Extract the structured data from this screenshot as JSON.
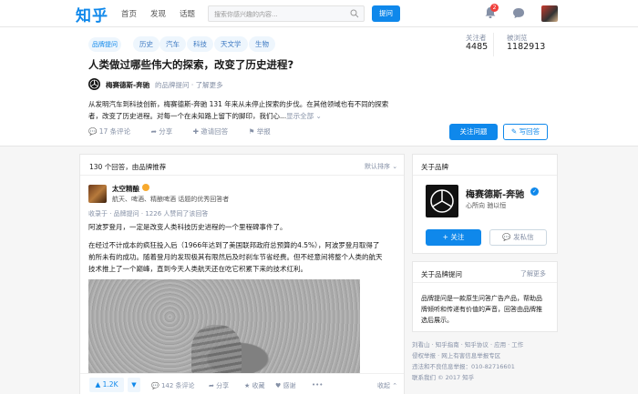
{
  "nav": {
    "logo": "知乎",
    "links": [
      "首页",
      "发现",
      "话题"
    ],
    "search_placeholder": "搜索你感兴趣的内容...",
    "ask_label": "提问",
    "notification_count": "2"
  },
  "question": {
    "brand_tag": "品牌提问",
    "topics": [
      "历史",
      "汽车",
      "科技",
      "天文学",
      "生物"
    ],
    "followers_label": "关注者",
    "followers_value": "4485",
    "views_label": "被浏览",
    "views_value": "1182913",
    "title": "人类做过哪些伟大的探索，改变了历史进程?",
    "brand_name": "梅赛德斯-奔驰",
    "brand_suffix": "的品牌提问 · 了解更多",
    "desc_line1": "从发明汽车到科技创新，梅赛德斯-奔驰 131 年来从未停止探索的步伐。在其他领域也有不同的探索",
    "desc_line2": "者，改变了历史进程。对每一个在未知路上留下的脚印，我们心...",
    "show_all": "显示全部 ⌄",
    "comments": "17 条评论",
    "share": "分享",
    "invite": "邀请回答",
    "report": "举报",
    "follow_btn": "关注问题",
    "write_btn": "写回答"
  },
  "answers": {
    "count_label": "130 个回答，由品牌推荐",
    "sort_label": "默认排序 ⌄",
    "author": "太空精酿",
    "bio": "航天、啤酒、精酿啤酒 话题的优秀回答者",
    "meta": "收录于 · 品牌提问 · 1226 人赞同了该回答",
    "lead": "阿波罗登月，一定是改变人类科技历史进程的一个里程碑事件了。",
    "body_line1": "在经过不计成本的疯狂投入后（1966年达到了美国联邦政府总预算的4.5%），阿波罗登月取得了",
    "body_line2": "前所未有的成功。随着登月的发现极其有限然后及时刹车节省经费。但不经意间将整个人类的航天",
    "body_line3": "技术推上了一个巅峰，直到今天人类航天还在吃它积累下来的技术红利。",
    "upvote": "▲ 1.2K",
    "downvote": "▼",
    "comments": "142 条评论",
    "share": "分享",
    "favorite": "收藏",
    "thanks": "感谢",
    "collapse": "收起 ⌃"
  },
  "sidebar": {
    "about_brand": "关于品牌",
    "brand_name": "梅赛德斯-奔驰",
    "motto": "心所向 驰以恒",
    "follow": "+ 关注",
    "message": "发私信",
    "about_q": "关于品牌提问",
    "learn_more": "了解更多",
    "desc": "品牌提问是一款原生问答广告产品，帮助品牌倾听和传递有价值的声音，回答由品牌推选后展示。",
    "footer_line1": "刘看山 · 知乎指南 · 知乎协议 · 应用 · 工作",
    "footer_line2": "侵权举报 · 网上有害信息举报专区",
    "footer_line3": "违法和不良信息举报：010-82716601",
    "footer_line4": "联系我们 © 2017 知乎"
  },
  "colors": {
    "accent": "#0f88eb",
    "badge": "#f1403c"
  }
}
